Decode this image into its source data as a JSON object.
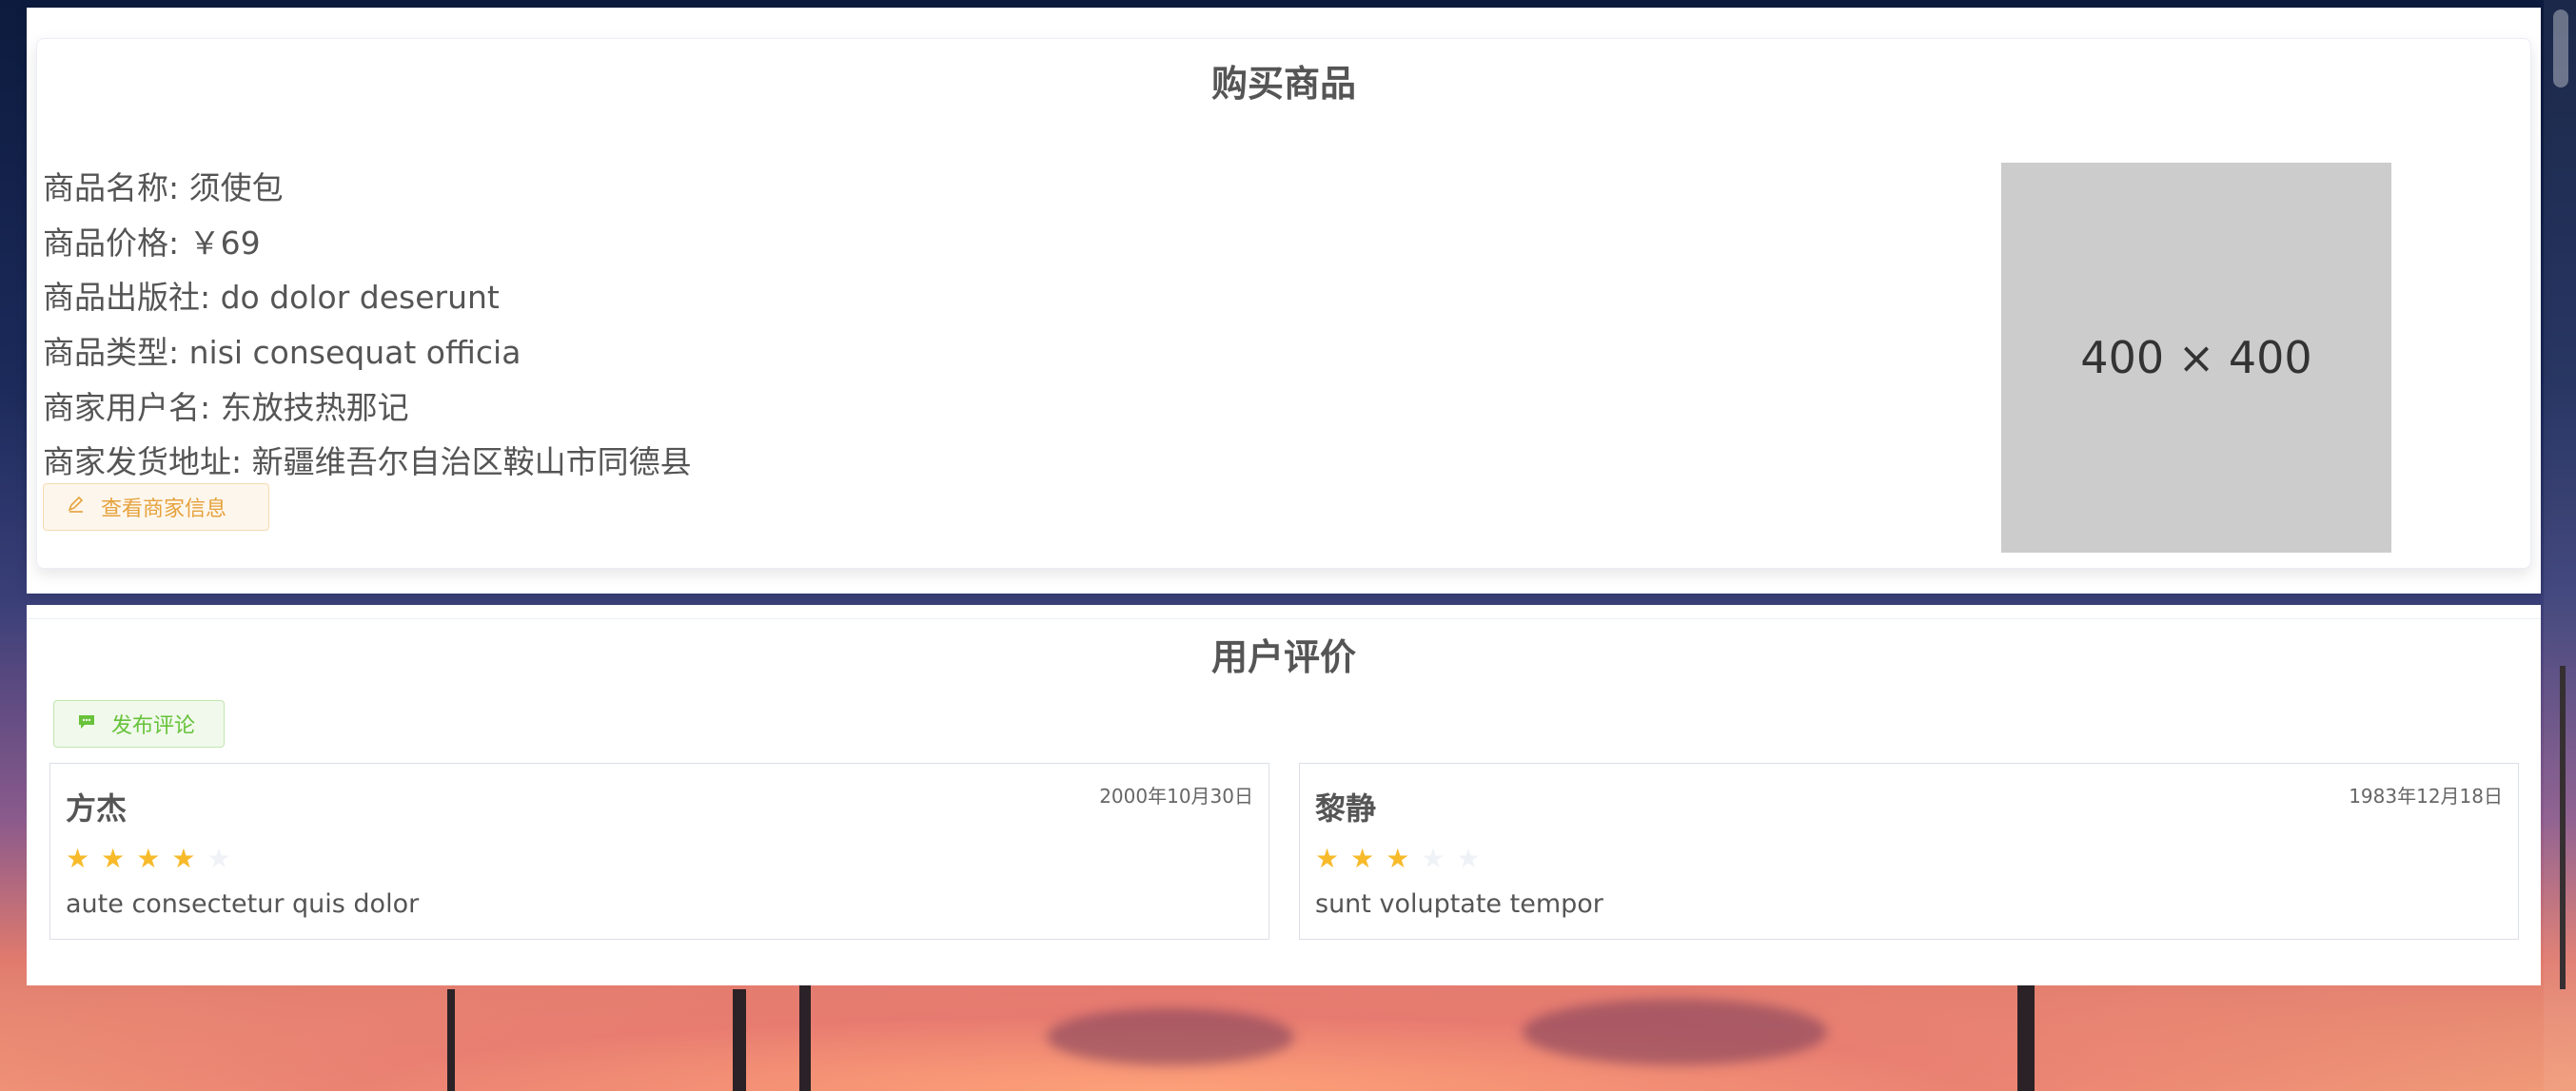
{
  "product": {
    "section_title": "购买商品",
    "name_line": "商品名称: 须使包",
    "price_line": "商品价格: ￥69",
    "publisher_line": "商品出版社: do dolor deserunt",
    "type_line": "商品类型: nisi consequat officia",
    "merchant_user_line": "商家用户名: 东放技热那记",
    "ship_address_line": "商家发货地址: 新疆维吾尔自治区鞍山市同德县",
    "view_merchant_button": "查看商家信息",
    "image_placeholder": "400 × 400"
  },
  "reviews": {
    "section_title": "用户评价",
    "post_comment_button": "发布评论",
    "items": [
      {
        "name": "方杰",
        "date": "2000年10月30日",
        "rating": 4,
        "max_rating": 5,
        "text": "aute consectetur quis dolor"
      },
      {
        "name": "黎静",
        "date": "1983年12月18日",
        "rating": 3,
        "max_rating": 5,
        "text": "sunt voluptate tempor"
      }
    ]
  },
  "colors": {
    "warning": "#e6a23c",
    "success": "#67c23a",
    "star_on": "#f7ba2a",
    "star_off": "#eff2f7"
  },
  "icons": {
    "view_merchant": "edit-pen-icon",
    "post_comment": "chat-bubble-icon",
    "star": "star-icon"
  }
}
